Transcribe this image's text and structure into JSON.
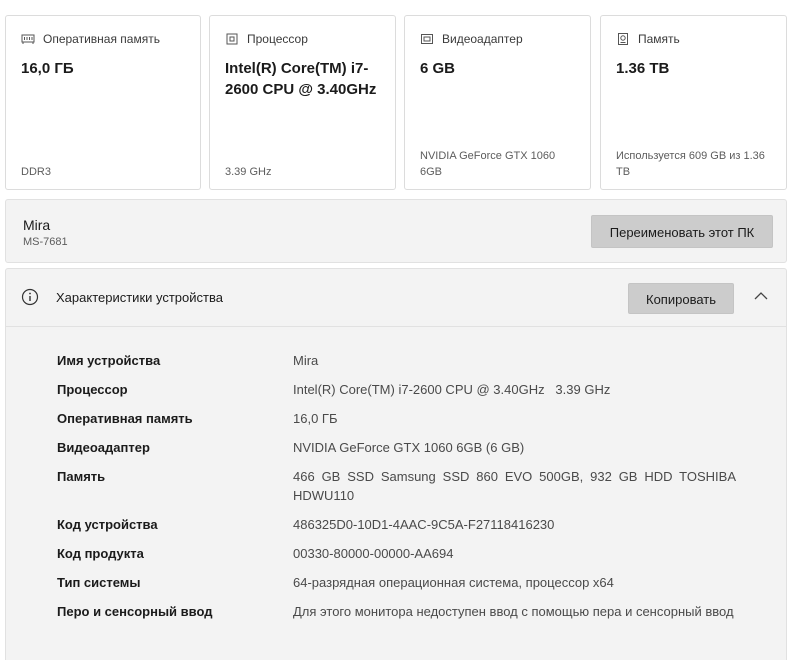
{
  "cards": [
    {
      "icon": "ram-icon",
      "title": "Оперативная память",
      "value": "16,0 ГБ",
      "footer": "DDR3"
    },
    {
      "icon": "processor-icon",
      "title": "Процессор",
      "value": "Intel(R) Core(TM) i7-2600 CPU @ 3.40GHz",
      "footer": "3.39 GHz"
    },
    {
      "icon": "display-adapter-icon",
      "title": "Видеоадаптер",
      "value": "6 GB",
      "footer": "NVIDIA GeForce GTX 1060 6GB"
    },
    {
      "icon": "storage-icon",
      "title": "Память",
      "value": "1.36 TB",
      "footer": "Используется 609 GB из 1.36 TB"
    }
  ],
  "pc": {
    "name": "Mira",
    "model": "MS-7681",
    "rename_label": "Переименовать этот ПК"
  },
  "specs": {
    "title": "Характеристики устройства",
    "copy_label": "Копировать",
    "rows": [
      {
        "label": "Имя устройства",
        "value": "Mira"
      },
      {
        "label": "Процессор",
        "value": "Intel(R) Core(TM) i7-2600 CPU @ 3.40GHz   3.39 GHz"
      },
      {
        "label": "Оперативная память",
        "value": "16,0 ГБ"
      },
      {
        "label": "Видеоадаптер",
        "value": "NVIDIA GeForce GTX 1060 6GB (6 GB)"
      },
      {
        "label": "Память",
        "value": "466 GB SSD Samsung SSD 860 EVO 500GB, 932 GB HDD TOSHIBA HDWU110"
      },
      {
        "label": "Код устройства",
        "value": "486325D0-10D1-4AAC-9C5A-F27118416230"
      },
      {
        "label": "Код продукта",
        "value": "00330-80000-00000-AA694"
      },
      {
        "label": "Тип системы",
        "value": "64-разрядная операционная система, процессор x64"
      },
      {
        "label": "Перо и сенсорный ввод",
        "value": "Для этого монитора недоступен ввод с помощью пера и сенсорный ввод"
      }
    ]
  }
}
